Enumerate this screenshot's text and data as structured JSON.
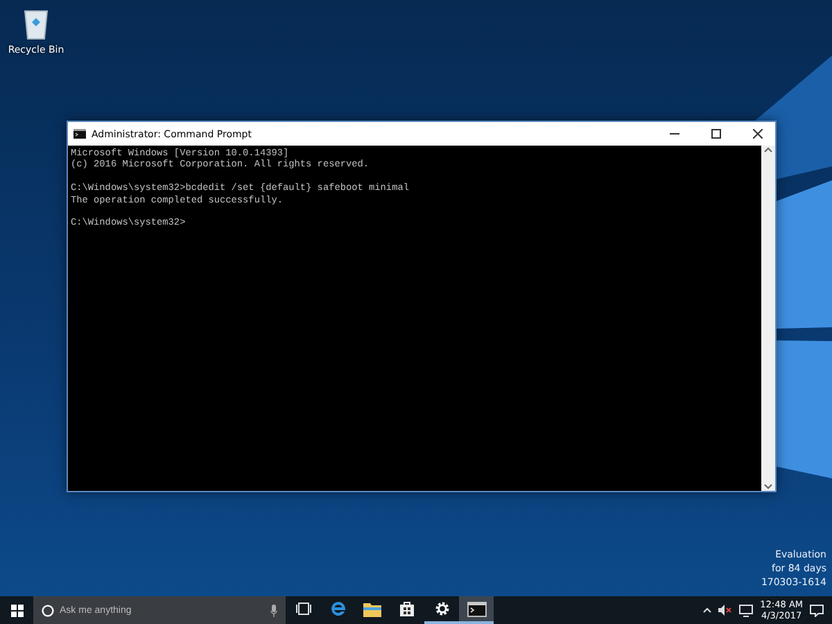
{
  "desktop_icons": [
    {
      "label": "Recycle Bin",
      "kind": "recycle-bin"
    }
  ],
  "window": {
    "title": "Administrator: Command Prompt",
    "console": [
      [
        "Microsoft Windows [Version 10.0.14393]",
        "(c) 2016 Microsoft Corporation. All rights reserved."
      ],
      [
        "C:\\Windows\\system32>bcdedit /set {default} safeboot minimal",
        "The operation completed successfully."
      ],
      [
        "C:\\Windows\\system32>"
      ]
    ]
  },
  "watermark_text": [
    "Evaluation",
    "for 84 days",
    "170303-1614"
  ],
  "taskbar": {
    "search": {
      "placeholder": "Ask me anything"
    },
    "apps": [
      {
        "kind": "task-view",
        "running": false,
        "active": false
      },
      {
        "kind": "edge",
        "running": false,
        "active": false
      },
      {
        "kind": "explorer",
        "running": false,
        "active": false
      },
      {
        "kind": "store",
        "running": false,
        "active": false
      },
      {
        "kind": "settings",
        "running": true,
        "active": false
      },
      {
        "kind": "cmd",
        "running": true,
        "active": true
      }
    ],
    "clock": {
      "time": "12:48 AM",
      "date": "4/3/2017"
    }
  }
}
